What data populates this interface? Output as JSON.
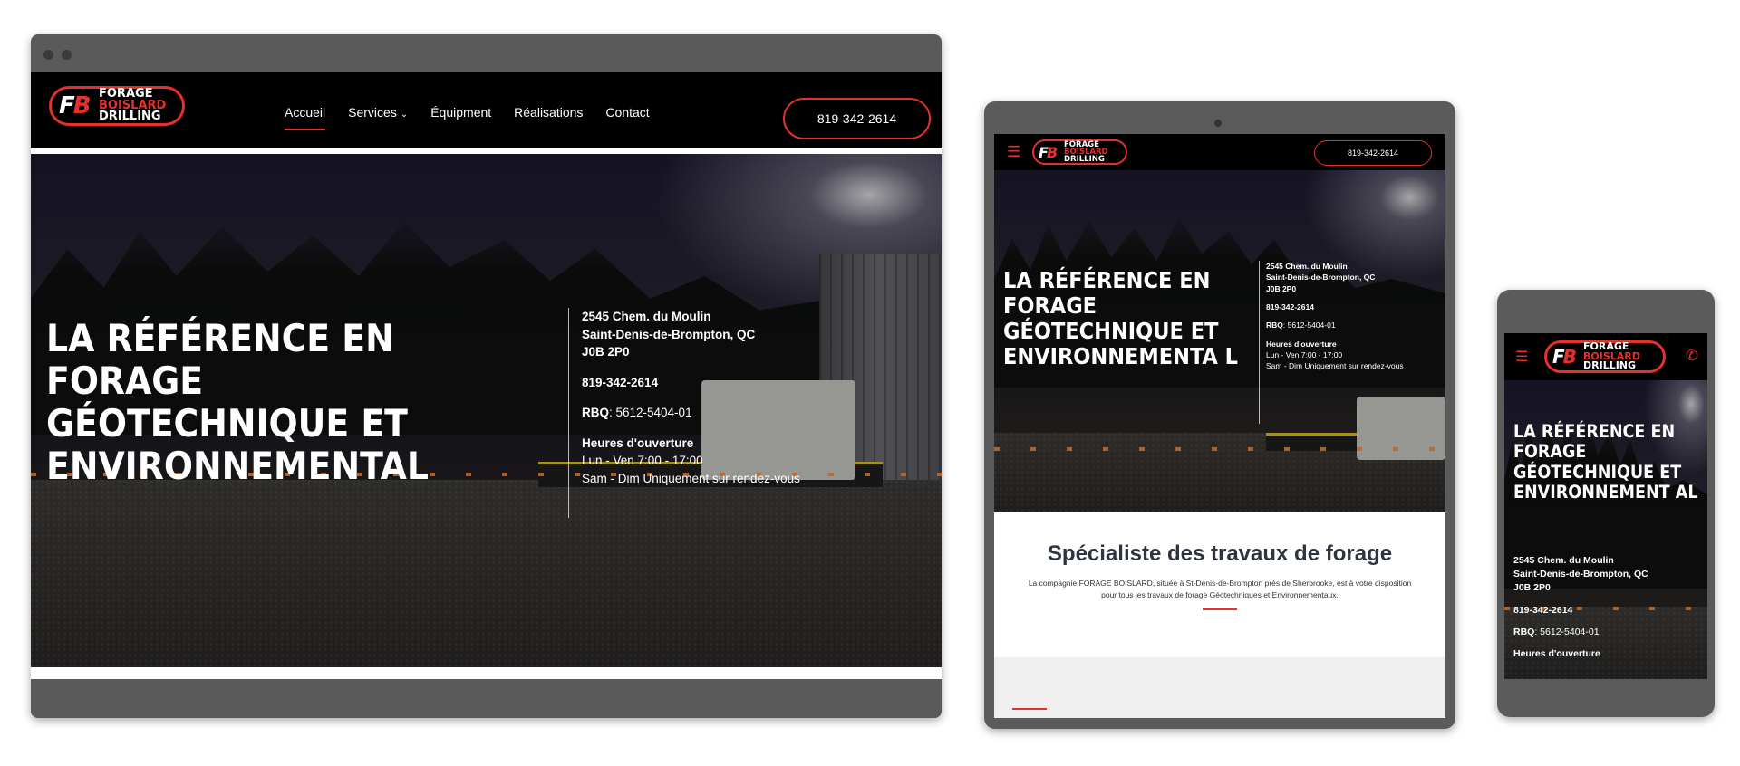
{
  "logo": {
    "mark_left": "F",
    "mark_right": "B",
    "line1": "FORAGE",
    "line2": "BOISLARD",
    "line3": "DRILLING"
  },
  "nav": {
    "items": [
      {
        "label": "Accueil",
        "active": true
      },
      {
        "label": "Services",
        "has_dropdown": true
      },
      {
        "label": "Équipment"
      },
      {
        "label": "Réalisations"
      },
      {
        "label": "Contact"
      }
    ],
    "chevron": "⌄",
    "phone": "819-342-2614"
  },
  "hero": {
    "title": "LA RÉFÉRENCE EN FORAGE GÉOTECHNIQUE ET ENVIRONNEMENTAL",
    "title_tablet": "LA RÉFÉRENCE EN FORAGE GÉOTECHNIQUE ET ENVIRONNEMENTA L",
    "title_phone": "LA RÉFÉRENCE EN FORAGE GÉOTECHNIQUE ET ENVIRONNEMENT AL",
    "address1": "2545 Chem. du Moulin",
    "address2": "Saint-Denis-de-Brompton, QC",
    "postal": "J0B 2P0",
    "phone": "819-342-2614",
    "rbq_label": "RBQ",
    "rbq_value": ": 5612-5404-01",
    "hours_label": "Heures d'ouverture",
    "hours_weekday": "Lun - Ven 7:00 - 17:00",
    "hours_weekend": "Sam - Dim Uniquement sur rendez-vous"
  },
  "intro": {
    "heading": "Spécialiste des travaux de forage",
    "body": "La compagnie FORAGE BOISLARD, située à St-Denis-de-Brompton près de Sherbrooke, est à votre disposition pour tous les travaux de forage Géotechniques et Environnementaux."
  },
  "icons": {
    "menu": "☰",
    "phone": "✆"
  },
  "colors": {
    "accent": "#e4312b",
    "nav_bg": "#000000",
    "frame": "#5a5a5a",
    "heading": "#2e3540"
  }
}
